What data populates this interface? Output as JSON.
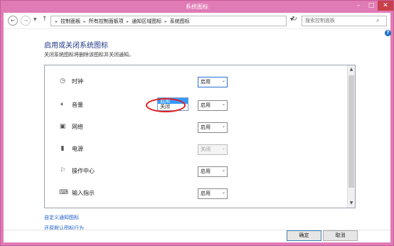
{
  "window": {
    "title": "系统图标"
  },
  "nav": {
    "breadcrumbs": [
      "控制面板",
      "所有控制面板项",
      "通知区域图标",
      "系统图标"
    ],
    "search_placeholder": "搜索控制面板"
  },
  "main": {
    "heading": "启用或关闭系统图标",
    "description": "关闭系统图标将删除该图标并关闭通知。"
  },
  "icons": [
    {
      "label": "时钟",
      "icon": "clock-icon",
      "value": "启用",
      "disabled": false
    },
    {
      "label": "音量",
      "icon": "speaker-icon",
      "value": "启用",
      "disabled": false
    },
    {
      "label": "网络",
      "icon": "network-icon",
      "value": "启用",
      "disabled": false
    },
    {
      "label": "电源",
      "icon": "power-icon",
      "value": "关闭",
      "disabled": true
    },
    {
      "label": "操作中心",
      "icon": "flag-icon",
      "value": "启用",
      "disabled": false
    },
    {
      "label": "输入指示",
      "icon": "keyboard-icon",
      "value": "启用",
      "disabled": false
    }
  ],
  "dropdown": {
    "options": [
      "启用",
      "关闭"
    ],
    "highlighted": "启用"
  },
  "links": {
    "customize": "自定义通知图标",
    "restore": "还原默认图标行为"
  },
  "buttons": {
    "ok": "确定",
    "cancel": "取消"
  },
  "colors": {
    "titlebar": "#e07bb5",
    "accent": "#1e3a8a",
    "link": "#1a5cc8",
    "highlight_ring": "#e02020"
  }
}
